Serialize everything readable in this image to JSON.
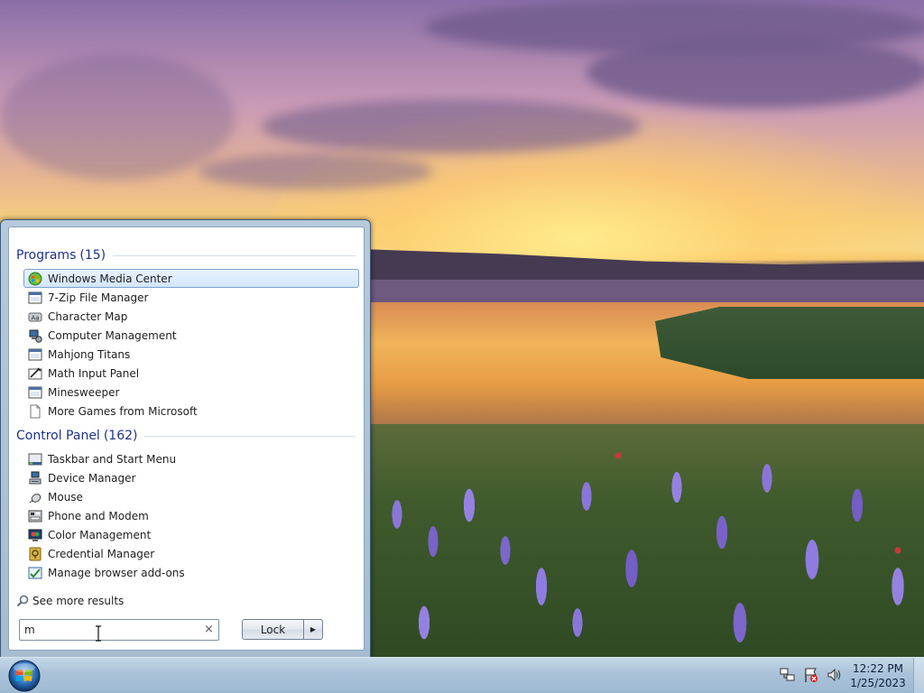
{
  "start_menu": {
    "groups": [
      {
        "title": "Programs",
        "count": "(15)",
        "items": [
          {
            "label": "Windows Media Center",
            "icon": "windows-media-center-icon",
            "selected": true
          },
          {
            "label": "7-Zip File Manager",
            "icon": "app-window-icon"
          },
          {
            "label": "Character Map",
            "icon": "character-map-icon"
          },
          {
            "label": "Computer Management",
            "icon": "computer-management-icon"
          },
          {
            "label": "Mahjong Titans",
            "icon": "app-window-icon"
          },
          {
            "label": "Math Input Panel",
            "icon": "math-input-icon"
          },
          {
            "label": "Minesweeper",
            "icon": "app-window-icon"
          },
          {
            "label": "More Games from Microsoft",
            "icon": "blank-document-icon"
          }
        ]
      },
      {
        "title": "Control Panel",
        "count": "(162)",
        "items": [
          {
            "label": "Taskbar and Start Menu",
            "icon": "taskbar-icon"
          },
          {
            "label": "Device Manager",
            "icon": "device-manager-icon"
          },
          {
            "label": "Mouse",
            "icon": "mouse-icon"
          },
          {
            "label": "Phone and Modem",
            "icon": "phone-modem-icon"
          },
          {
            "label": "Color Management",
            "icon": "color-management-icon"
          },
          {
            "label": "Credential Manager",
            "icon": "credential-manager-icon"
          },
          {
            "label": "Manage browser add-ons",
            "icon": "browser-addons-icon"
          }
        ]
      }
    ],
    "see_more": "See more results",
    "search": {
      "value": "m",
      "clear": "×"
    },
    "lock_button": "Lock",
    "lock_arrow": "▶"
  },
  "taskbar": {
    "clock_time": "12:22 PM",
    "clock_date": "1/25/2023",
    "tray": [
      "network-icon",
      "action-center-flag-icon",
      "volume-icon"
    ]
  }
}
